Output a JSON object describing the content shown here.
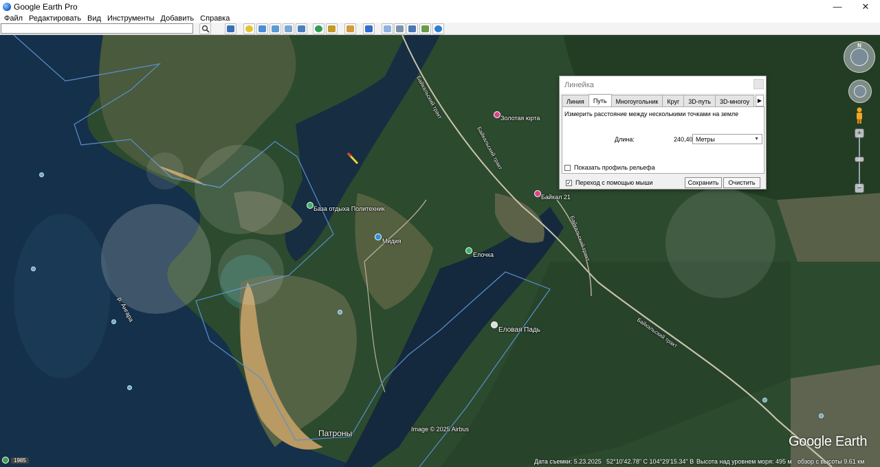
{
  "window": {
    "title": "Google Earth Pro",
    "minimize": "—",
    "maximize": "❐",
    "close": "✕"
  },
  "menu": [
    "Файл",
    "Редактировать",
    "Вид",
    "Инструменты",
    "Добавить",
    "Справка"
  ],
  "search": {
    "value": "",
    "placeholder": ""
  },
  "toolbar_icons": [
    "sidebar-toggle-icon",
    "placemark-icon",
    "polygon-icon",
    "path-icon",
    "overlay-icon",
    "tour-icon",
    "history-icon",
    "sun-icon",
    "planets-icon",
    "ruler-icon",
    "email-icon",
    "print-icon",
    "save-image-icon",
    "maps-icon",
    "earth-icon"
  ],
  "map": {
    "places": [
      {
        "name": "Золотая юрта",
        "pin_color": "#e0408a"
      },
      {
        "name": "Байкал 21",
        "pin_color": "#e0408a"
      },
      {
        "name": "База отдыха Политехник",
        "pin_color": "#3ab36b"
      },
      {
        "name": "Мидия",
        "pin_color": "#2f8fe0"
      },
      {
        "name": "Елочка",
        "pin_color": "#3ab36b"
      },
      {
        "name": "Еловая Падь",
        "pin_color": "#dddddd"
      },
      {
        "name": "р. Ангара",
        "pin_color": ""
      },
      {
        "name": "Патроны",
        "pin_color": ""
      }
    ],
    "roads": [
      "Байкальский тракт",
      "Байкальский тракт",
      "Байкальский тракт",
      "Байкальский тракт"
    ],
    "image_credit": "Image © 2025 Airbus",
    "logo": "Google Earth"
  },
  "ruler_dialog": {
    "title": "Линейка",
    "tabs": [
      "Линия",
      "Путь",
      "Многоугольник",
      "Круг",
      "3D-путь",
      "3D-многоу"
    ],
    "active_tab": "Путь",
    "description": "Измерить расстояние между несколькими точками на земле",
    "length_label": "Длина:",
    "length_value": "240,40",
    "units": "Метры",
    "show_profile_label": "Показать профиль рельефа",
    "show_profile_checked": false,
    "mouse_nav_label": "Переход с помощью мыши",
    "mouse_nav_checked": true,
    "save_label": "Сохранить",
    "clear_label": "Очистить"
  },
  "nav": {
    "north": "N",
    "zoom_in": "+",
    "zoom_out": "−"
  },
  "status_bar": {
    "year": "1985",
    "imagery_date": "Дата съемки: 5.23.2025",
    "coordinates": "52°10'42.78\" С   104°29'15.34\" В",
    "elevation": "Высота над уровнем моря:  495 м",
    "eye_alt": "обзор с высоты   9.61 км"
  }
}
